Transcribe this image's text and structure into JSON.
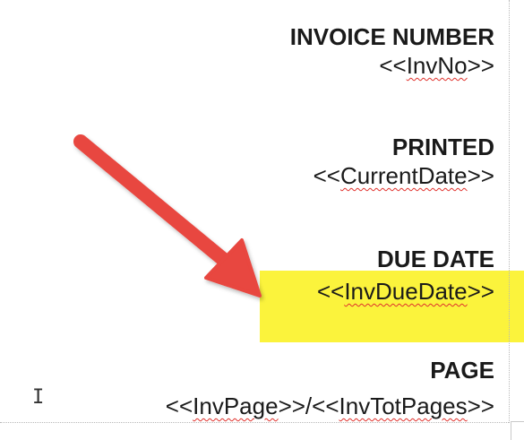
{
  "document": {
    "blocks": [
      {
        "label": "INVOICE NUMBER",
        "field_open": "<<",
        "field_name": "InvNo",
        "field_close": ">>"
      },
      {
        "label": "PRINTED",
        "field_open": "<<",
        "field_name": "CurrentDate",
        "field_close": ">>"
      },
      {
        "label": "DUE DATE",
        "field_open": "<<",
        "field_name": "InvDueDate",
        "field_close": ">>"
      },
      {
        "label": "PAGE",
        "field_open": "<<",
        "field_name": "InvPage",
        "field_sep": ">>/<<",
        "field_name_2": "InvTotPages",
        "field_close": ">>"
      }
    ]
  },
  "colors": {
    "highlight": "#fbf33c",
    "arrow": "#e8463f",
    "spellcheck": "#e0312c"
  },
  "icons": {
    "cursor": "text-cursor-icon",
    "arrow": "annotation-arrow-icon"
  }
}
